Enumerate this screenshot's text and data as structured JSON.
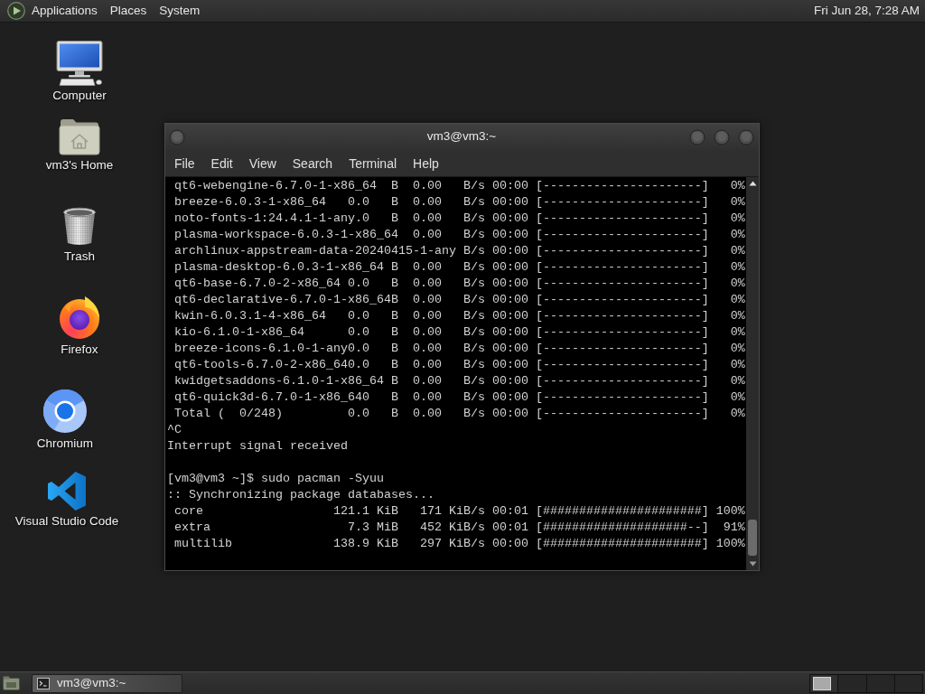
{
  "top_panel": {
    "menus": [
      "Applications",
      "Places",
      "System"
    ],
    "clock": "Fri Jun 28, 7:28 AM"
  },
  "desktop_icons": [
    {
      "label": "Computer",
      "kind": "computer"
    },
    {
      "label": "vm3's Home",
      "kind": "home"
    },
    {
      "label": "Trash",
      "kind": "trash"
    },
    {
      "label": "Firefox",
      "kind": "firefox"
    },
    {
      "label": "Chromium",
      "kind": "chromium"
    },
    {
      "label": "Visual Studio Code",
      "kind": "vscode"
    }
  ],
  "window": {
    "title": "vm3@vm3:~",
    "menu": [
      "File",
      "Edit",
      "View",
      "Search",
      "Terminal",
      "Help"
    ],
    "terminal": {
      "blocks": [
        {
          "lines": [
            " qt6-webengine-6.7.0-1-x86_64  B  0.00   B/s 00:00 [----------------------]   0%",
            " breeze-6.0.3-1-x86_64   0.0   B  0.00   B/s 00:00 [----------------------]   0%",
            " noto-fonts-1:24.4.1-1-any.0   B  0.00   B/s 00:00 [----------------------]   0%",
            " plasma-workspace-6.0.3-1-x86_64  0.00   B/s 00:00 [----------------------]   0%",
            " archlinux-appstream-data-20240415-1-any B/s 00:00 [----------------------]   0%",
            " plasma-desktop-6.0.3-1-x86_64 B  0.00   B/s 00:00 [----------------------]   0%",
            " qt6-base-6.7.0-2-x86_64 0.0   B  0.00   B/s 00:00 [----------------------]   0%",
            " qt6-declarative-6.7.0-1-x86_64B  0.00   B/s 00:00 [----------------------]   0%",
            " kwin-6.0.3.1-4-x86_64   0.0   B  0.00   B/s 00:00 [----------------------]   0%",
            " kio-6.1.0-1-x86_64      0.0   B  0.00   B/s 00:00 [----------------------]   0%",
            " breeze-icons-6.1.0-1-any0.0   B  0.00   B/s 00:00 [----------------------]   0%",
            " qt6-tools-6.7.0-2-x86_640.0   B  0.00   B/s 00:00 [----------------------]   0%",
            " kwidgetsaddons-6.1.0-1-x86_64 B  0.00   B/s 00:00 [----------------------]   0%",
            " qt6-quick3d-6.7.0-1-x86_640   B  0.00   B/s 00:00 [----------------------]   0%",
            " Total (  0/248)         0.0   B  0.00   B/s 00:00 [----------------------]   0%",
            "^C",
            "Interrupt signal received"
          ]
        },
        {
          "lines": [
            "[vm3@vm3 ~]$ sudo pacman -Syuu",
            ":: Synchronizing package databases...",
            " core                  121.1 KiB   171 KiB/s 00:01 [######################] 100%",
            " extra                   7.3 MiB   452 KiB/s 00:01 [####################--]  91%",
            " multilib              138.9 KiB   297 KiB/s 00:00 [######################] 100%"
          ]
        }
      ]
    }
  },
  "taskbar": {
    "windows": [
      {
        "title": "vm3@vm3:~",
        "selected": true
      }
    ]
  }
}
